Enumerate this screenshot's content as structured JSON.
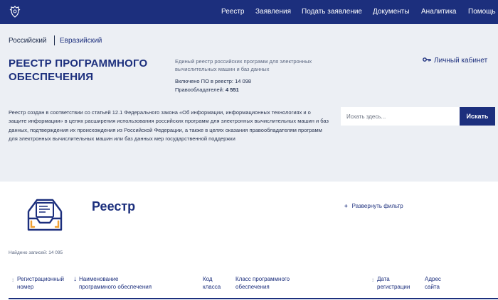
{
  "nav": {
    "items": [
      {
        "label": "Реестр"
      },
      {
        "label": "Заявления"
      },
      {
        "label": "Подать заявление"
      },
      {
        "label": "Документы"
      },
      {
        "label": "Аналитика"
      },
      {
        "label": "Помощь"
      }
    ]
  },
  "registry_switch": {
    "russian": "Российский",
    "eurasian": "Евразийский"
  },
  "hero": {
    "title": "РЕЕСТР ПРОГРАММНОГО ОБЕСПЕЧЕНИЯ",
    "subtitle": "Единый реестр российских программ для электронных вычислительных машин и баз данных",
    "included": "Включено ПО в реестр: 14 098",
    "holders_label": "Правообладателей: ",
    "holders_value": "4 551",
    "description": "Реестр создан в соответствии со статьей 12.1 Федерального закона «Об информации, информационных технологиях и о защите информации» в целях расширения использования российских программ для электронных вычислительных машин и баз данных, подтверждения их происхождения из Российской Федерации, а также в целях оказания правообладателям программ для электронных вычислительных машин или баз данных мер государственной поддержки"
  },
  "cabinet": {
    "label": "Личный кабинет",
    "icon": "key-icon"
  },
  "search": {
    "placeholder": "Искать здесь...",
    "button": "Искать"
  },
  "registry": {
    "title": "Реестр",
    "filter_toggle": "Развернуть фильтр",
    "found": "Найдено записей: 14 095"
  },
  "table": {
    "columns": [
      {
        "line1": "Регистрационный",
        "line2": "номер"
      },
      {
        "line1": "Наименование",
        "line2": "программного обеспечения"
      },
      {
        "line1": "Код",
        "line2": "класса"
      },
      {
        "line1": "Класс программного",
        "line2": "обеспечения"
      },
      {
        "line1": "Дата",
        "line2": "регистрации"
      },
      {
        "line1": "Адрес",
        "line2": "сайта"
      }
    ]
  },
  "colors": {
    "brand": "#1c2f7d",
    "hero_bg": "#eceff4",
    "accent": "#f0a032"
  }
}
